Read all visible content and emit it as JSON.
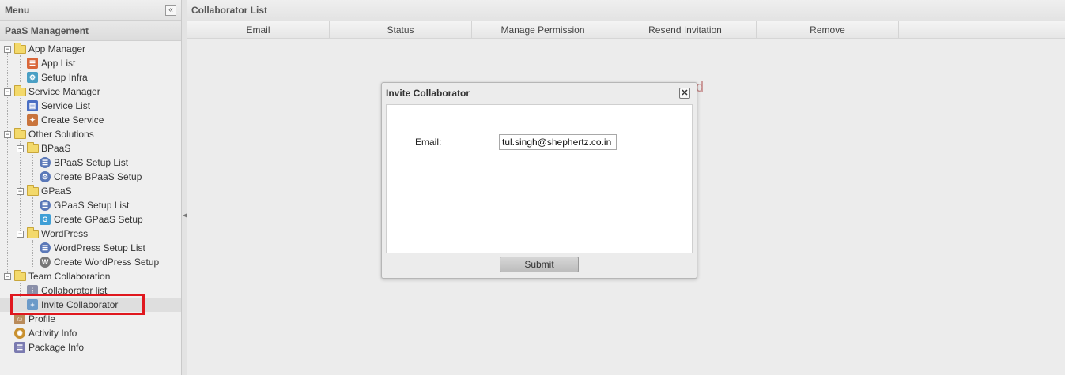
{
  "sidebar": {
    "title": "Menu",
    "collapse_icon": "«",
    "section": "PaaS Management",
    "tree": {
      "app_manager": "App Manager",
      "app_list": "App List",
      "setup_infra": "Setup Infra",
      "service_manager": "Service Manager",
      "service_list": "Service List",
      "create_service": "Create Service",
      "other_solutions": "Other Solutions",
      "bpaas": "BPaaS",
      "bpaas_setup_list": "BPaaS Setup List",
      "create_bpaas_setup": "Create BPaaS Setup",
      "gpaas": "GPaaS",
      "gpaas_setup_list": "GPaaS Setup List",
      "create_gpaas_setup": "Create GPaaS Setup",
      "wordpress": "WordPress",
      "wordpress_setup_list": "WordPress Setup List",
      "create_wordpress_setup": "Create WordPress Setup",
      "team_collaboration": "Team Collaboration",
      "collaborator_list": "Collaborator list",
      "invite_collaborator": "Invite Collaborator",
      "profile": "Profile",
      "activity_info": "Activity Info",
      "package_info": "Package Info"
    }
  },
  "main": {
    "title": "Collaborator List",
    "columns": [
      "Email",
      "Status",
      "Manage Permission",
      "Resend Invitation",
      "Remove"
    ],
    "ghost_text": "d"
  },
  "dialog": {
    "title": "Invite Collaborator",
    "close_icon": "✕",
    "email_label": "Email:",
    "email_value": "tul.singh@shephertz.co.in",
    "submit_label": "Submit"
  },
  "colors": {
    "highlight": "#e0171e"
  }
}
